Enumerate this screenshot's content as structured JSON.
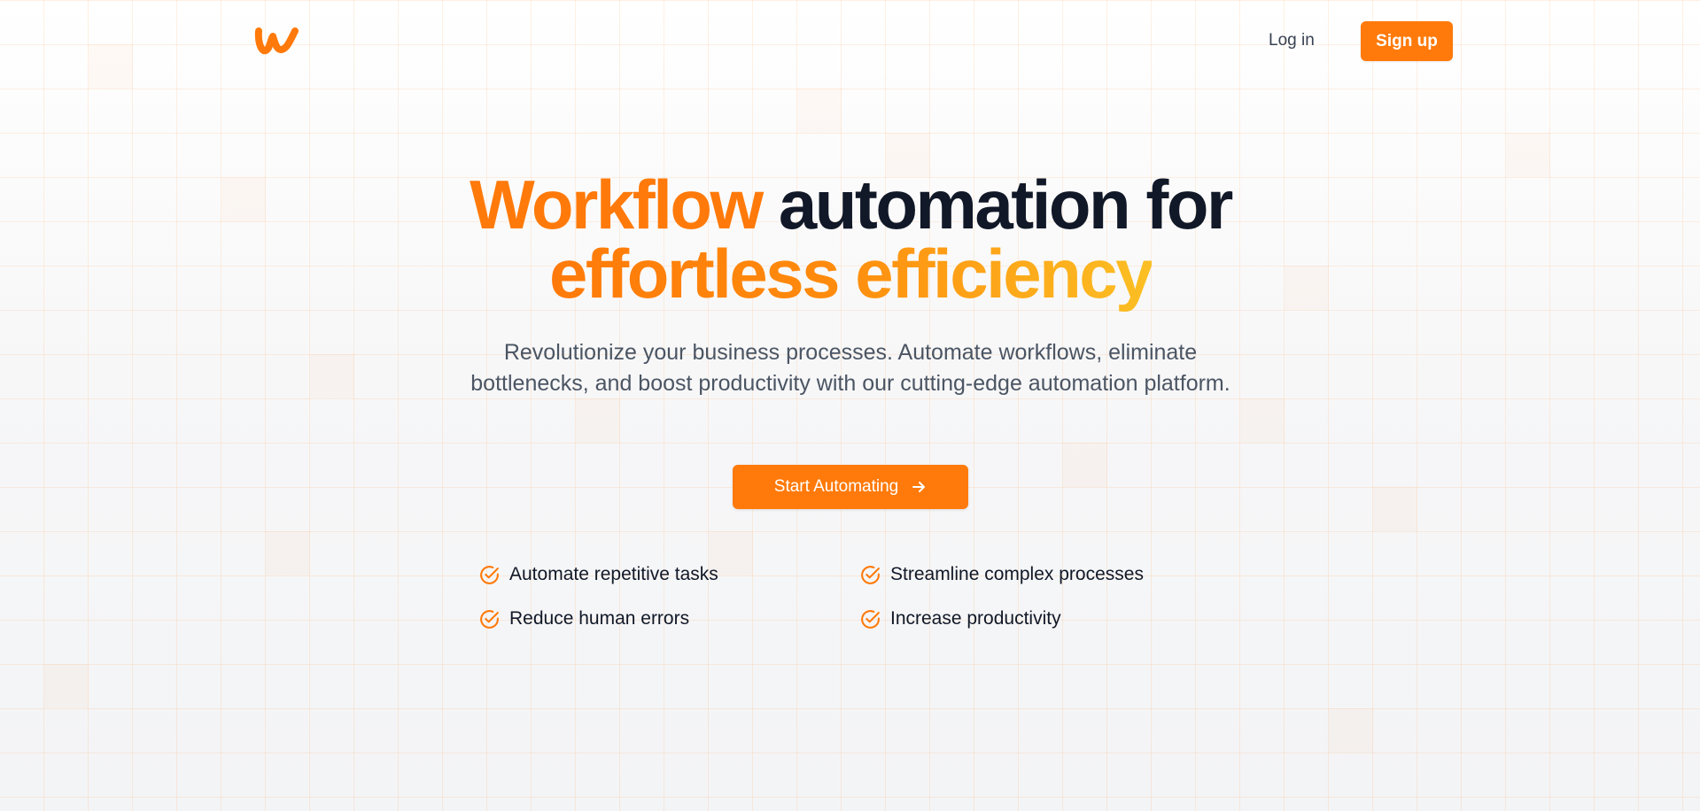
{
  "brand": {
    "logo_icon": "w-logo-icon",
    "accent_color": "#ff7a0a",
    "accent_gradient_end": "#fbbf24",
    "heading_color": "#111827"
  },
  "nav": {
    "login_label": "Log in",
    "signup_label": "Sign up"
  },
  "hero": {
    "title_highlight": "Workflow",
    "title_rest": " automation for",
    "title_line2": "effortless efficiency",
    "subtitle": "Revolutionize your business processes. Automate workflows, eliminate bottlenecks, and boost productivity with our cutting-edge automation platform.",
    "cta_label": "Start Automating",
    "cta_icon": "arrow-right-icon"
  },
  "features": {
    "icon": "check-circle-icon",
    "items": [
      "Automate repetitive tasks",
      "Streamline complex processes",
      "Reduce human errors",
      "Increase productivity"
    ]
  }
}
